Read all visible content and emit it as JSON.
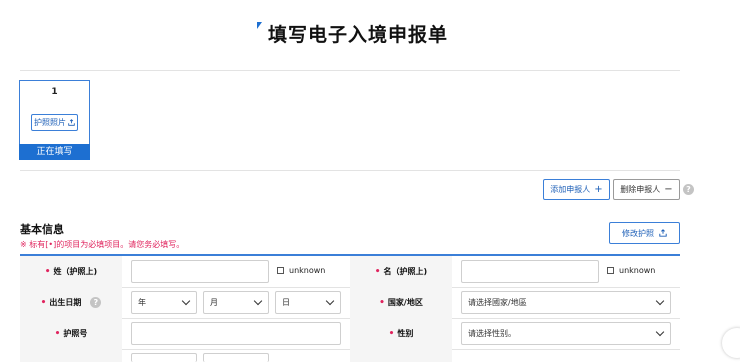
{
  "header": {
    "title": "填写电子入境申报单"
  },
  "applicant": {
    "number": "1",
    "photo_button": "护照照片",
    "status": "正在填写"
  },
  "actions": {
    "add_label": "添加申报人",
    "add_symbol": "+",
    "delete_label": "删除申报人",
    "delete_symbol": "−",
    "help_symbol": "?"
  },
  "section": {
    "title": "基本信息",
    "required_note": "※ 标有[•]的项目为必填项目。请您务必填写。",
    "modify_button": "修改护照"
  },
  "form": {
    "required_mark": "•",
    "surname_label": "姓（护照上)",
    "surname_value": "",
    "unknown_label": "unknown",
    "given_name_label": "名（护照上)",
    "given_name_value": "",
    "birthdate_label": "出生日期",
    "year_placeholder": "年",
    "month_placeholder": "月",
    "day_placeholder": "日",
    "country_label": "国家/地区",
    "country_placeholder": "请选择國家/地區",
    "passport_label": "护照号",
    "passport_value": "",
    "gender_label": "性别",
    "gender_placeholder": "请选择性别。"
  }
}
